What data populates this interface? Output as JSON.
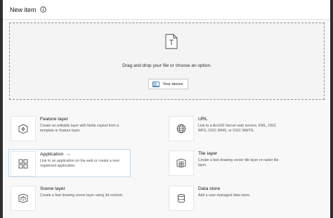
{
  "dialog": {
    "title": "New item",
    "info_icon": "info-circle-icon"
  },
  "dropzone": {
    "file_icon": "file-upload-icon",
    "prompt": "Drag and drop your file or choose an option.",
    "device_button_label": "Your device",
    "device_icon": "laptop-icon"
  },
  "items": [
    {
      "title": "Feature layer",
      "description": "Create an editable layer with fields copied from a template or feature layer.",
      "icon": "feature-layer-icon"
    },
    {
      "title": "URL",
      "description": "Link to a ArcGIS Server web service, KML, OGC WFS, OGC WMS, or OGC WMTS.",
      "icon": "globe-icon"
    },
    {
      "title": "Application",
      "arrow": "→",
      "description": "Link to an application on the web or create a new registered application.",
      "icon": "apps-grid-icon"
    },
    {
      "title": "Tile layer",
      "description": "Create a fast drawing vector tile layer or raster tile layer.",
      "icon": "tile-layer-icon"
    },
    {
      "title": "Scene layer",
      "description": "Create a fast drawing scene layer using 3d content.",
      "icon": "scene-layer-icon"
    },
    {
      "title": "Data store",
      "description": "Add a user-managed data store.",
      "icon": "database-icon"
    }
  ],
  "colors": {
    "selected_border": "#c5d9ec",
    "dialog_background": "#f8f8f8"
  }
}
